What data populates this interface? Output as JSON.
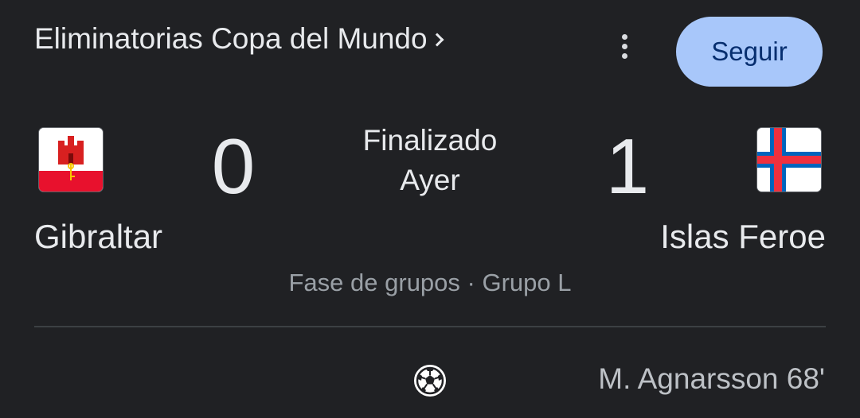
{
  "header": {
    "title": "Eliminatorias Copa del Mundo",
    "follow_label": "Seguir"
  },
  "icons": {
    "title_chevron": "chevron-right-icon",
    "more": "more-vert-icon",
    "goal": "soccer-ball-icon"
  },
  "match": {
    "home": {
      "name": "Gibraltar",
      "score": "0",
      "flag": "gibraltar-flag"
    },
    "away": {
      "name": "Islas Feroe",
      "score": "1",
      "flag": "faroe-islands-flag"
    },
    "status": "Finalizado",
    "date": "Ayer",
    "stage": "Fase de grupos · Grupo L"
  },
  "events": [
    {
      "scorer": "M. Agnarsson 68'",
      "team": "away",
      "type": "goal"
    }
  ],
  "colors": {
    "background": "#202124",
    "follow_button": "#a8c7fa",
    "text_primary": "#e8eaed",
    "text_secondary": "#9aa0a6"
  }
}
